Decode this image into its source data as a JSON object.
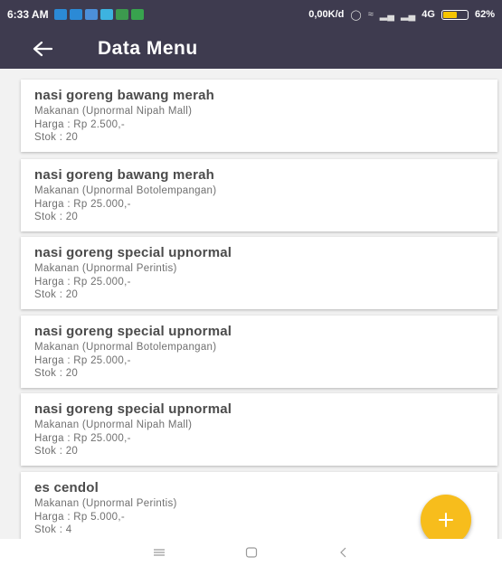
{
  "status_bar": {
    "time": "6:33 AM",
    "speed": "0,00K/d",
    "network": "4G",
    "battery": "62%",
    "battery_level": 0.62,
    "notification_colors": [
      "#2b8ad6",
      "#2b8ad6",
      "#4c8fd9",
      "#3db3e0",
      "#3c9a4e",
      "#38a34e"
    ]
  },
  "app_bar": {
    "title": "Data Menu",
    "background": "#3e3b4f",
    "back_icon": "arrow-left-icon"
  },
  "labels": {
    "price_prefix": "Harga : ",
    "stock_prefix": "Stok : "
  },
  "menu_items": [
    {
      "name": "nasi goreng bawang merah",
      "category": "Makanan (Upnormal Nipah Mall)",
      "price": "Harga : Rp 2.500,-",
      "stock": "Stok : 20"
    },
    {
      "name": "nasi goreng bawang merah",
      "category": "Makanan (Upnormal Botolempangan)",
      "price": "Harga : Rp 25.000,-",
      "stock": "Stok : 20"
    },
    {
      "name": "nasi goreng special upnormal",
      "category": "Makanan (Upnormal Perintis)",
      "price": "Harga : Rp 25.000,-",
      "stock": "Stok : 20"
    },
    {
      "name": "nasi goreng special upnormal",
      "category": "Makanan (Upnormal Botolempangan)",
      "price": "Harga : Rp 25.000,-",
      "stock": "Stok : 20"
    },
    {
      "name": "nasi goreng special upnormal",
      "category": "Makanan (Upnormal Nipah Mall)",
      "price": "Harga : Rp 25.000,-",
      "stock": "Stok : 20"
    },
    {
      "name": "es cendol",
      "category": "Makanan (Upnormal Perintis)",
      "price": "Harga : Rp 5.000,-",
      "stock": "Stok : 4"
    }
  ],
  "fab": {
    "icon": "plus-icon",
    "color": "#f7bd1c"
  },
  "nav_bar": {
    "icons": [
      "menu-icon",
      "home-square-icon",
      "back-chevron-icon"
    ]
  }
}
